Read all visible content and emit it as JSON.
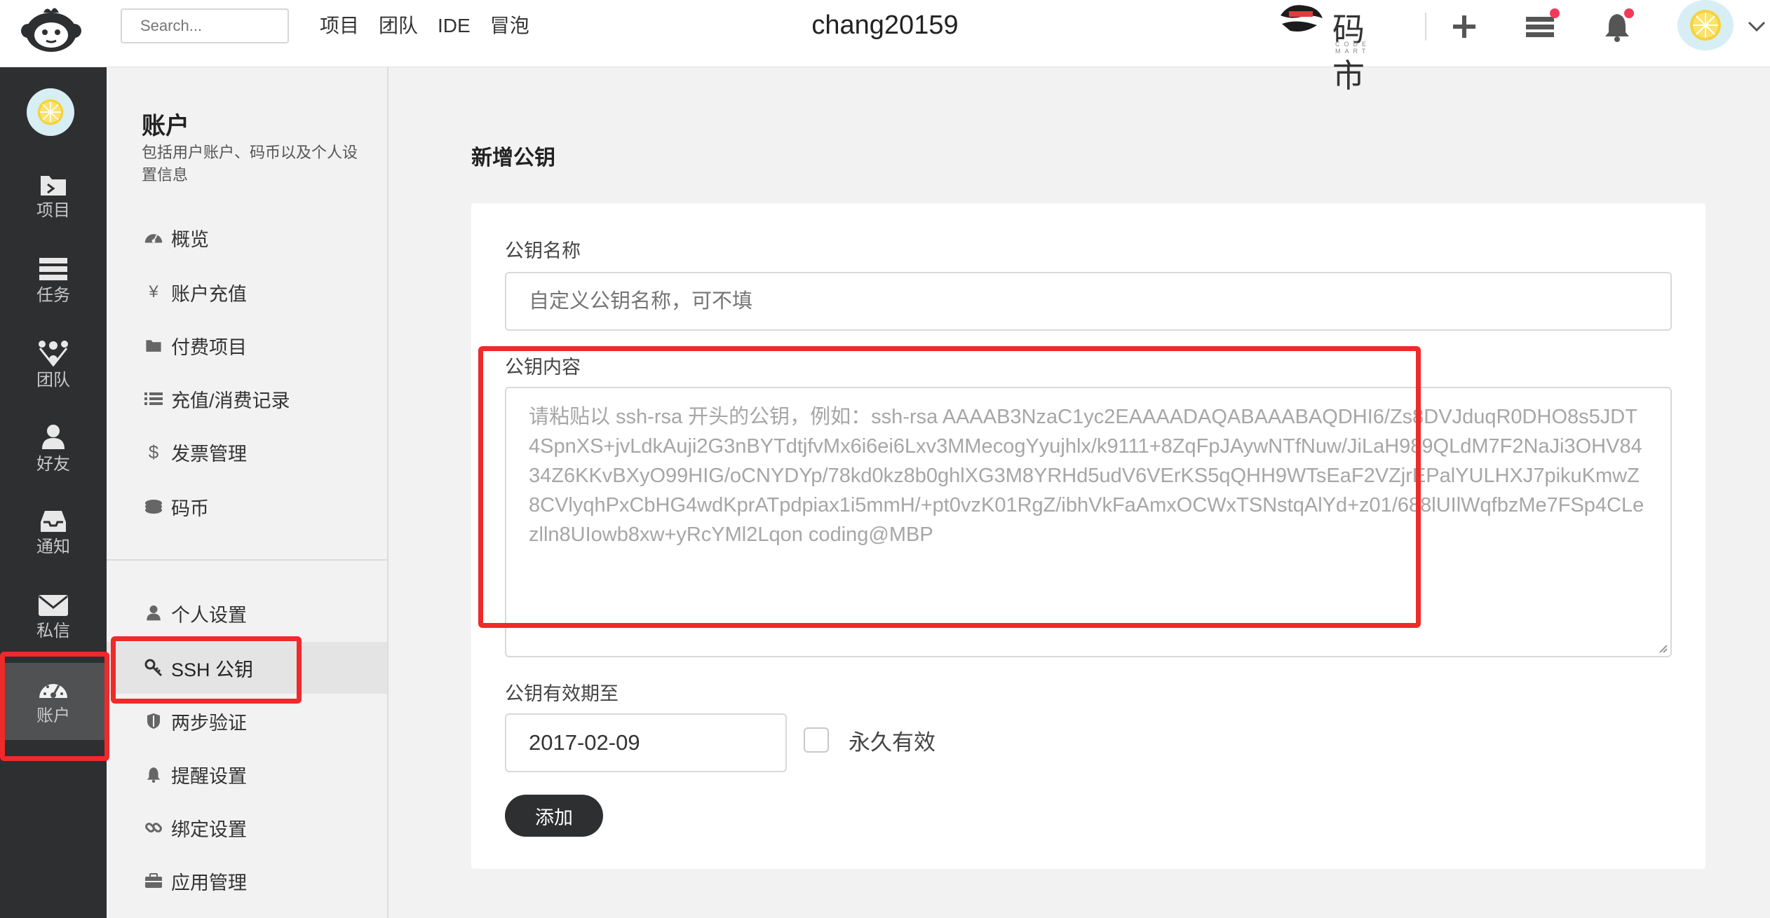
{
  "header": {
    "search_placeholder": "Search...",
    "nav": [
      "项目",
      "团队",
      "IDE",
      "冒泡"
    ],
    "username": "chang20159",
    "codemart_text": "码市",
    "codemart_sub": "CODE MART"
  },
  "dark_sidebar": {
    "items": [
      {
        "label": "项目",
        "icon": "folder-icon"
      },
      {
        "label": "任务",
        "icon": "tasks-icon"
      },
      {
        "label": "团队",
        "icon": "team-icon"
      },
      {
        "label": "好友",
        "icon": "user-icon"
      },
      {
        "label": "通知",
        "icon": "inbox-icon"
      },
      {
        "label": "私信",
        "icon": "mail-icon"
      },
      {
        "label": "账户",
        "icon": "dashboard-icon",
        "active": true
      }
    ]
  },
  "sub_sidebar": {
    "title": "账户",
    "description": "包括用户账户、码币以及个人设置信息",
    "group1": [
      {
        "label": "概览",
        "icon": "dashboard-icon"
      },
      {
        "label": "账户充值",
        "icon": "yen-icon"
      },
      {
        "label": "付费项目",
        "icon": "folder-icon"
      },
      {
        "label": "充值/消费记录",
        "icon": "list-icon"
      },
      {
        "label": "发票管理",
        "icon": "dollar-icon"
      },
      {
        "label": "码币",
        "icon": "coins-icon"
      }
    ],
    "group2": [
      {
        "label": "个人设置",
        "icon": "user-icon"
      },
      {
        "label": "SSH 公钥",
        "icon": "key-icon",
        "active": true
      },
      {
        "label": "两步验证",
        "icon": "shield-icon"
      },
      {
        "label": "提醒设置",
        "icon": "bell-icon"
      },
      {
        "label": "绑定设置",
        "icon": "link-icon"
      },
      {
        "label": "应用管理",
        "icon": "briefcase-icon"
      }
    ]
  },
  "main": {
    "title": "新增公钥",
    "name_label": "公钥名称",
    "name_placeholder": "自定义公钥名称，可不填",
    "content_label": "公钥内容",
    "content_placeholder": "请粘贴以 ssh-rsa 开头的公钥，例如：ssh-rsa AAAAB3NzaC1yc2EAAAADAQABAAABAQDHI6/Zs8DVJduqR0DHO8s5JDT4SpnXS+jvLdkAuji2G3nBYTdtjfvMx6i6ei6Lxv3MMecogYyujhlx/k9111+8ZqFpJAywNTfNuw/JiLaH989QLdM7F2NaJi3OHV8434Z6KKvBXyO99HIG/oCNYDYp/78kd0kz8b0ghlXG3M8YRHd5udV6VErKS5qQHH9WTsEaF2VZjrEPalYULHXJ7pikuKmwZ8CVlyqhPxCbHG4wdKprATpdpiax1i5mmH/+pt0vzK01RgZ/ibhVkFaAmxOCWxTSNstqAlYd+z01/688lUIlWqfbzMe7FSp4CLezlln8UIowb8xw+yRcYMl2Lqon coding@MBP",
    "expiry_label": "公钥有效期至",
    "expiry_value": "2017-02-09",
    "permanent_label": "永久有效",
    "add_button": "添加"
  },
  "colors": {
    "dark_sidebar_bg": "#2e2f30",
    "annotation_red": "#ee2a2a",
    "notification_dot": "#f03a5a"
  }
}
